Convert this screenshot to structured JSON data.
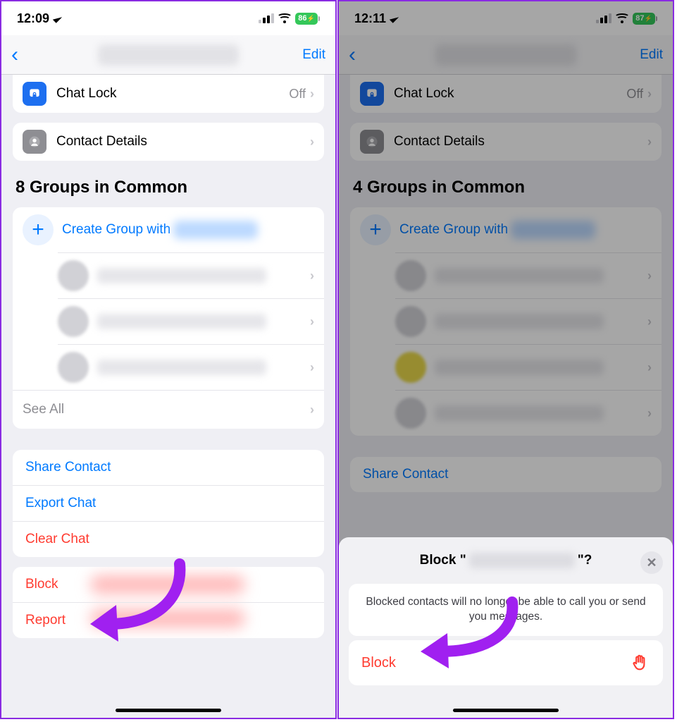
{
  "left": {
    "status": {
      "time": "12:09",
      "battery": "86"
    },
    "nav": {
      "edit": "Edit"
    },
    "rows": {
      "chat_lock_label": "Chat Lock",
      "chat_lock_value": "Off",
      "contact_details": "Contact Details"
    },
    "groups": {
      "heading": "8 Groups in Common",
      "create_label": "Create Group with",
      "see_all": "See All"
    },
    "actions": {
      "share": "Share Contact",
      "export": "Export Chat",
      "clear": "Clear Chat",
      "block": "Block",
      "report": "Report"
    }
  },
  "right": {
    "status": {
      "time": "12:11",
      "battery": "87"
    },
    "nav": {
      "edit": "Edit"
    },
    "rows": {
      "chat_lock_label": "Chat Lock",
      "chat_lock_value": "Off",
      "contact_details": "Contact Details"
    },
    "groups": {
      "heading": "4 Groups in Common",
      "create_label": "Create Group with"
    },
    "actions": {
      "share": "Share Contact"
    },
    "sheet": {
      "title_prefix": "Block \"",
      "title_suffix": "\"?",
      "body": "Blocked contacts will no longer be able to call you or send you messages.",
      "block": "Block"
    }
  }
}
